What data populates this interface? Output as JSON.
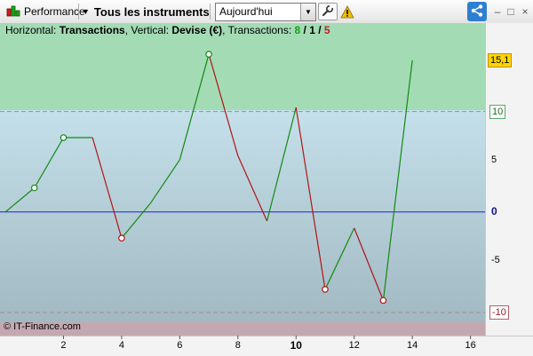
{
  "toolbar": {
    "performance_label": "Performance",
    "instruments_label": "Tous les instruments",
    "period_value": "Aujourd'hui",
    "icons": [
      "performance-chart-icon",
      "dropdown-caret-icon",
      "wrench-icon",
      "warning-icon",
      "share-icon",
      "minimize-icon",
      "maximize-icon",
      "close-icon"
    ],
    "window_buttons": {
      "minimize": "–",
      "maximize": "□",
      "close": "×"
    }
  },
  "header": {
    "horizontal_label": "Horizontal: ",
    "horizontal_value": "Transactions",
    "vertical_label": ", Vertical: ",
    "vertical_value": "Devise (€)",
    "transactions_label": ", Transactions: ",
    "wins": "8",
    "sep1": " / ",
    "neutral": "1",
    "sep2": " / ",
    "losses": "5"
  },
  "copyright": "© IT-Finance.com",
  "colors": {
    "up": "#138a13",
    "down": "#b01515",
    "zero_line": "#2020c8",
    "green_zone": "#a3dbb4",
    "pink_zone": "#c4a8b0"
  },
  "chart_data": {
    "type": "line",
    "x": [
      0,
      1,
      2,
      3,
      4,
      5,
      6,
      7,
      8,
      9,
      10,
      11,
      12,
      13,
      14
    ],
    "y": [
      0,
      2.4,
      7.4,
      7.4,
      -2.6,
      0.9,
      5.2,
      15.7,
      5.6,
      -0.9,
      10.4,
      -7.7,
      -1.6,
      -8.8,
      15.1
    ],
    "markers": [
      1,
      2,
      4,
      7,
      11,
      13
    ],
    "xlim": [
      0,
      16.5
    ],
    "ylim": [
      -12.3,
      18.8
    ],
    "x_ticks": [
      "2",
      "4",
      "6",
      "8",
      "10",
      "12",
      "14",
      "16"
    ],
    "x_tick_values": [
      2,
      4,
      6,
      8,
      10,
      12,
      14,
      16
    ],
    "bold_tick": "10",
    "y_ticks": [
      "5",
      "-5"
    ],
    "y_tick_values": [
      5,
      -5
    ],
    "zero_label": "0",
    "upper_threshold": "10",
    "lower_threshold": "-10",
    "last_value_label": "15,1",
    "last_value": 15.1
  }
}
